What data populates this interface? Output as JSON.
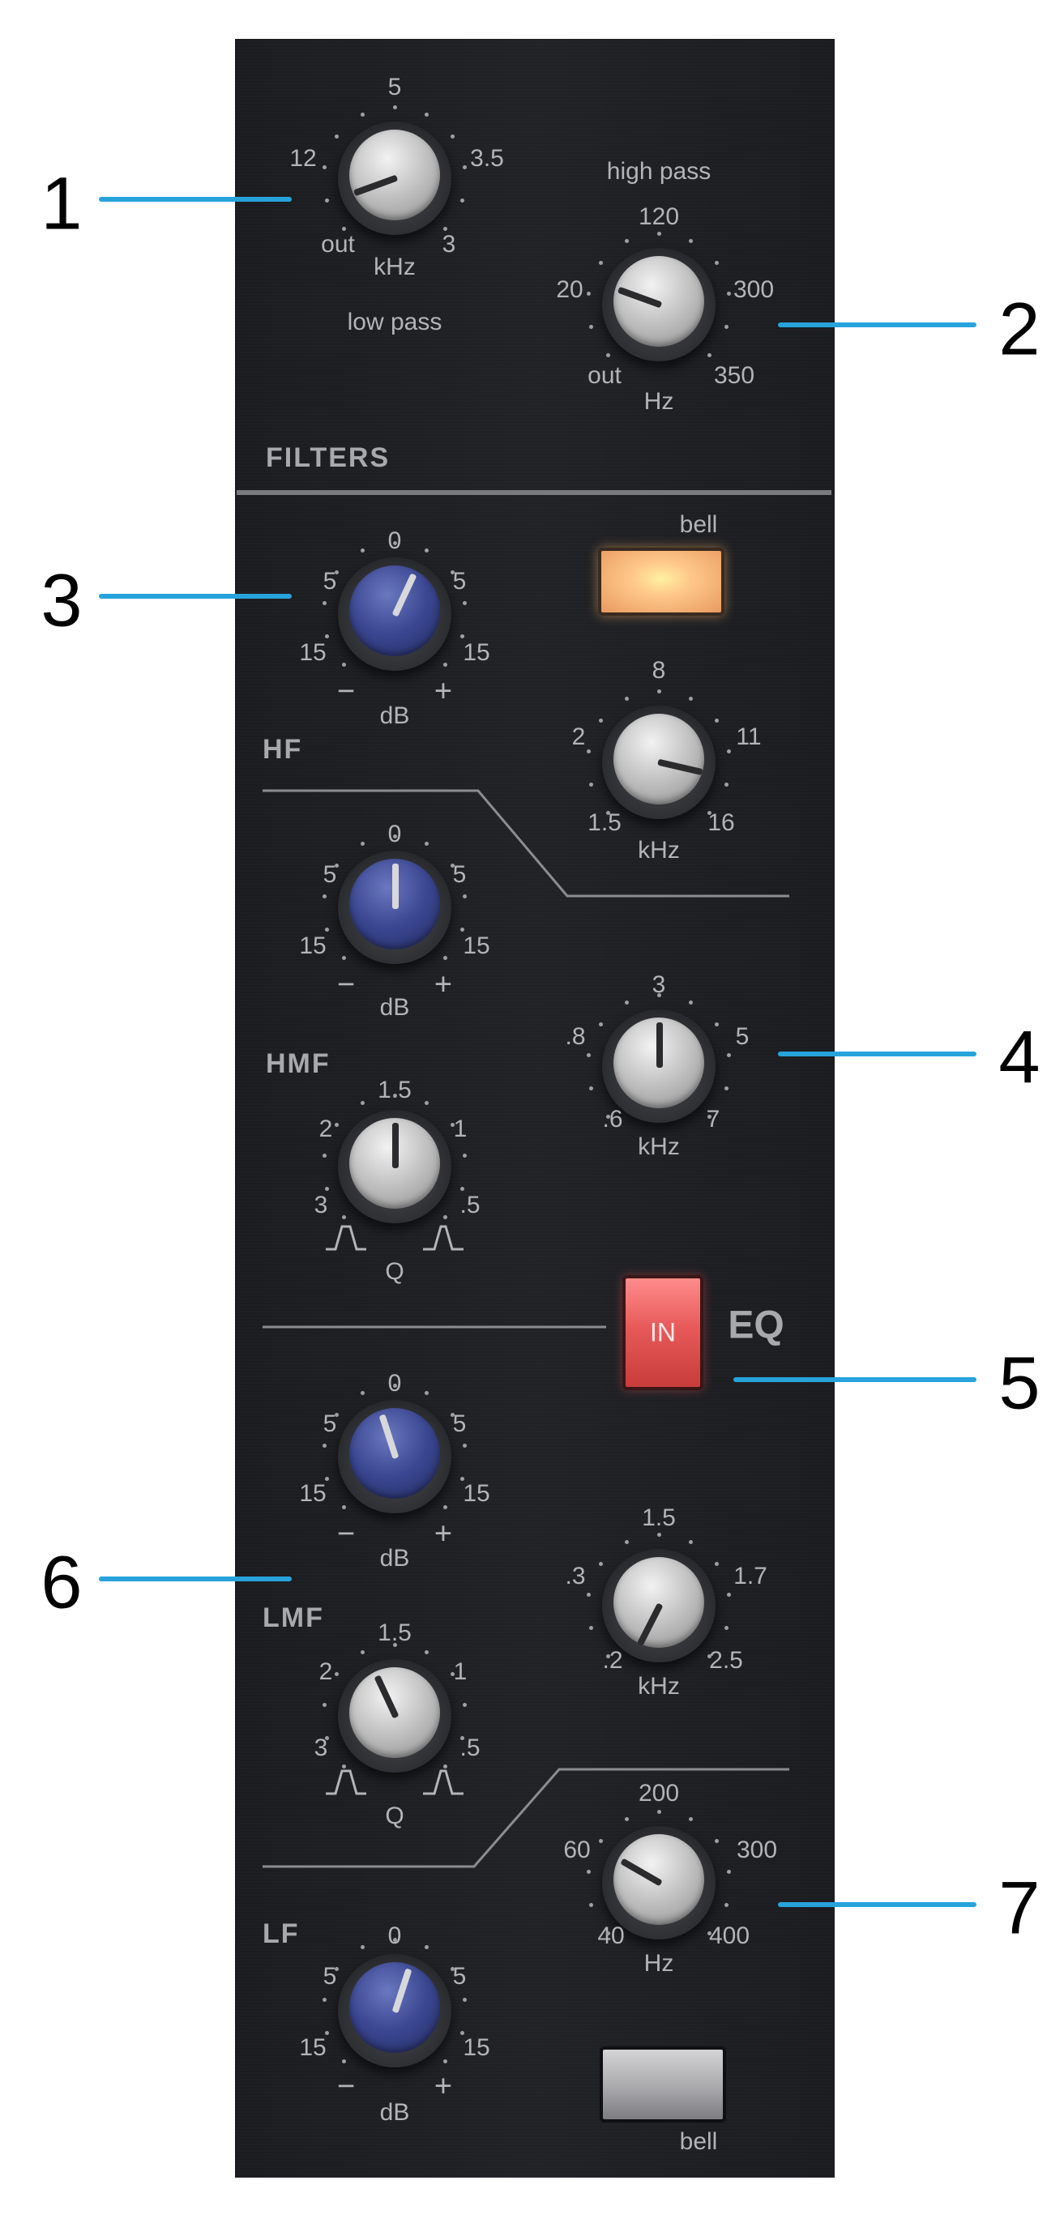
{
  "callouts": [
    "1",
    "2",
    "3",
    "4",
    "5",
    "6",
    "7"
  ],
  "filters": {
    "section": "FILTERS",
    "low_pass": {
      "ticks": [
        "5",
        "12",
        "3.5",
        "out",
        "3"
      ],
      "unit": "kHz",
      "name": "low pass"
    },
    "high_pass": {
      "name": "high pass",
      "ticks": [
        "120",
        "20",
        "300",
        "out",
        "350"
      ],
      "unit": "Hz"
    }
  },
  "hf": {
    "section": "HF",
    "bell_label": "bell",
    "gain": {
      "ticks": [
        "0",
        "5",
        "5",
        "15",
        "15"
      ],
      "minus": "−",
      "plus": "+",
      "unit": "dB"
    },
    "freq": {
      "ticks": [
        "8",
        "2",
        "11",
        "1.5",
        "16"
      ],
      "unit": "kHz"
    }
  },
  "hmf": {
    "section": "HMF",
    "gain": {
      "ticks": [
        "0",
        "5",
        "5",
        "15",
        "15"
      ],
      "minus": "−",
      "plus": "+",
      "unit": "dB"
    },
    "freq": {
      "ticks": [
        "3",
        ".8",
        "5",
        ".6",
        "7"
      ],
      "unit": "kHz"
    },
    "q": {
      "ticks": [
        "1.5",
        "2",
        "1",
        "3",
        ".5"
      ],
      "unit": "Q"
    }
  },
  "eq": {
    "in_label": "IN",
    "label": "EQ"
  },
  "lmf": {
    "section": "LMF",
    "gain": {
      "ticks": [
        "0",
        "5",
        "5",
        "15",
        "15"
      ],
      "minus": "−",
      "plus": "+",
      "unit": "dB"
    },
    "freq": {
      "ticks": [
        "1.5",
        ".3",
        "1.7",
        ".2",
        "2.5"
      ],
      "unit": "kHz"
    },
    "q": {
      "ticks": [
        "1.5",
        "2",
        "1",
        "3",
        ".5"
      ],
      "unit": "Q"
    }
  },
  "lf": {
    "section": "LF",
    "gain": {
      "ticks": [
        "0",
        "5",
        "5",
        "15",
        "15"
      ],
      "minus": "−",
      "plus": "+",
      "unit": "dB"
    },
    "freq": {
      "ticks": [
        "200",
        "60",
        "300",
        "40",
        "400"
      ],
      "unit": "Hz"
    },
    "bell_label": "bell"
  },
  "colors": {
    "callout": "#27a3dc",
    "gain_knob": "#3a4690",
    "in_button": "#e85a5a",
    "bell_lit": "#ffd080"
  }
}
